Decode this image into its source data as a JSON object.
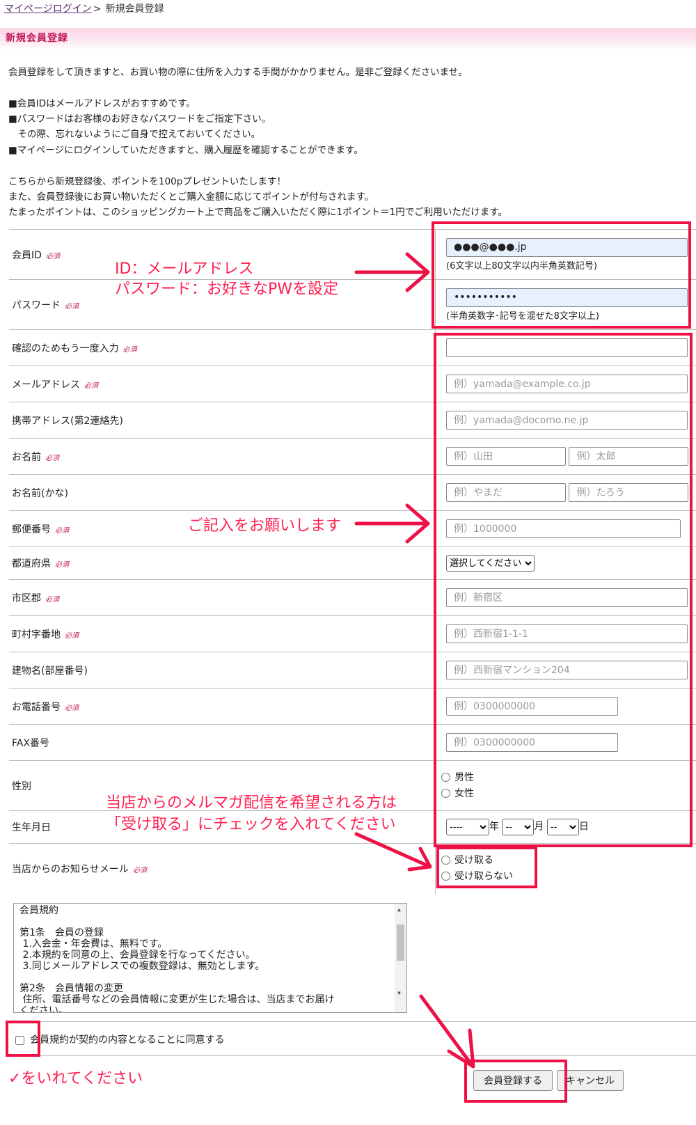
{
  "breadcrumb": {
    "link": "マイページログイン",
    "sep": ">",
    "current": "新規会員登録"
  },
  "header": {
    "title": "新規会員登録"
  },
  "intro": {
    "lines": [
      "会員登録をして頂きますと、お買い物の際に住所を入力する手間がかかりません。是非ご登録くださいませ。",
      "■会員IDはメールアドレスがおすすめです。",
      "■パスワードはお客様のお好きなパスワードをご指定下さい。",
      "　その際、忘れないようにご自身で控えておいてください。",
      "■マイページにログインしていただきますと、購入履歴を確認することができます。",
      "こちらから新規登録後、ポイントを100pプレゼントいたします！",
      "また、会員登録後にお買い物いただくとご購入金額に応じてポイントが付与されます。",
      "たまったポイントは、このショッピングカート上で商品をご購入いただく際に1ポイント＝1円でご利用いただけます。"
    ]
  },
  "required": "必須",
  "fields": {
    "member_id": {
      "label": "会員ID",
      "value": "●●●@●●●.jp",
      "note": "(6文字以上80文字以内半角英数記号)"
    },
    "password": {
      "label": "パスワード",
      "value": "•••••••••••",
      "note": "(半角英数字･記号を混ぜた8文字以上)"
    },
    "confirm": {
      "label": "確認のためもう一度入力",
      "value": ""
    },
    "email": {
      "label": "メールアドレス",
      "placeholder": "例）yamada@example.co.jp"
    },
    "mobile": {
      "label": "携帯アドレス(第2連絡先)",
      "placeholder": "例）yamada@docomo.ne.jp"
    },
    "name": {
      "label": "お名前",
      "placeholder_last": "例）山田",
      "placeholder_first": "例）太郎"
    },
    "kana": {
      "label": "お名前(かな)",
      "placeholder_last": "例）やまだ",
      "placeholder_first": "例）たろう"
    },
    "zip": {
      "label": "郵便番号",
      "placeholder": "例）1000000"
    },
    "pref": {
      "label": "都道府県",
      "selected": "選択してください"
    },
    "city": {
      "label": "市区郡",
      "placeholder": "例）新宿区"
    },
    "town": {
      "label": "町村字番地",
      "placeholder": "例）西新宿1-1-1"
    },
    "building": {
      "label": "建物名(部屋番号)",
      "placeholder": "例）西新宿マンション204"
    },
    "phone": {
      "label": "お電話番号",
      "placeholder": "例）0300000000"
    },
    "fax": {
      "label": "FAX番号",
      "placeholder": "例）0300000000"
    },
    "gender": {
      "label": "性別",
      "options": [
        "男性",
        "女性"
      ]
    },
    "birthday": {
      "label": "生年月日",
      "year": "----",
      "year_unit": "年",
      "month": "--",
      "month_unit": "月",
      "day": "--",
      "day_unit": "日"
    },
    "newsletter": {
      "label": "当店からのお知らせメール",
      "options": [
        "受け取る",
        "受け取らない"
      ]
    }
  },
  "terms": {
    "text": "会員規約\n\n第1条　会員の登録\n 1.入会金・年会費は、無料です。\n 2.本規約を同意の上、会員登録を行なってください。\n 3.同じメールアドレスでの複数登録は、無効とします。\n\n第2条　会員情報の変更\n 住所、電話番号などの会員情報に変更が生じた場合は、当店までお届け\nください。",
    "agree_label": "会員規約が契約の内容となることに同意する"
  },
  "buttons": {
    "submit": "会員登録する",
    "cancel": "キャンセル"
  },
  "annotations": {
    "id_pw_1": "ID：メールアドレス",
    "id_pw_2": "パスワード：お好きなPWを設定",
    "fill": "ご記入をお願いします",
    "mail_1": "当店からのメルマガ配信を希望される方は",
    "mail_2": "「受け取る」にチェックを入れてください",
    "check": "✓をいれてください"
  },
  "colors": {
    "accent": "#c2185b",
    "annotation": "#ee1146"
  }
}
